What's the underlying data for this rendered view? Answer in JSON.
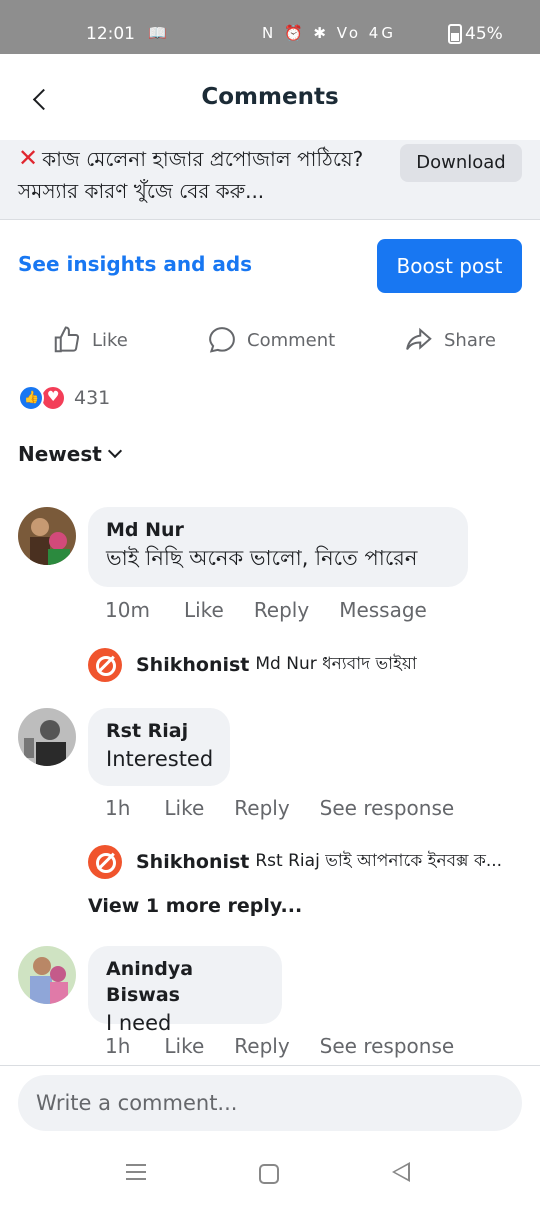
{
  "status_bar": {
    "time": "12:01",
    "battery": "45%",
    "icons_text": "N ⏰ ✱ Vo 4G"
  },
  "header": {
    "title": "Comments",
    "back_icon": "chevron-left-icon"
  },
  "post": {
    "text": "কাজ মেলেনা হাজার প্রপোজাল পাঠিয়ে? সমস্যার কারণ খুঁজে বের করু...",
    "download_label": "Download"
  },
  "insights": {
    "link_label": "See insights and ads",
    "boost_label": "Boost post"
  },
  "actions": {
    "like": "Like",
    "comment": "Comment",
    "share": "Share"
  },
  "reactions": {
    "count": "431"
  },
  "sort": {
    "label": "Newest"
  },
  "comments": [
    {
      "author": "Md Nur",
      "text": "ভাই নিছি অনেক ভালো, নিতে পারেন",
      "time": "10m",
      "like": "Like",
      "reply": "Reply",
      "extra": "Message",
      "replies": [
        {
          "author": "Shikhonist",
          "text": "Md Nur ধন্যবাদ ভাইয়া"
        }
      ]
    },
    {
      "author": "Rst Riaj",
      "text": "Interested",
      "time": "1h",
      "like": "Like",
      "reply": "Reply",
      "extra": "See response",
      "replies": [
        {
          "author": "Shikhonist",
          "text": "Rst Riaj ভাই আপনাকে ইনবক্স ক..."
        }
      ],
      "more_replies": "View 1 more reply..."
    },
    {
      "author": "Anindya Biswas",
      "text": "I need",
      "time": "1h",
      "like": "Like",
      "reply": "Reply",
      "extra": "See response"
    }
  ],
  "composer": {
    "placeholder": "Write a comment..."
  },
  "colors": {
    "accent": "#1877f2",
    "bubble": "#f0f2f5",
    "secondary_text": "#65676b"
  }
}
